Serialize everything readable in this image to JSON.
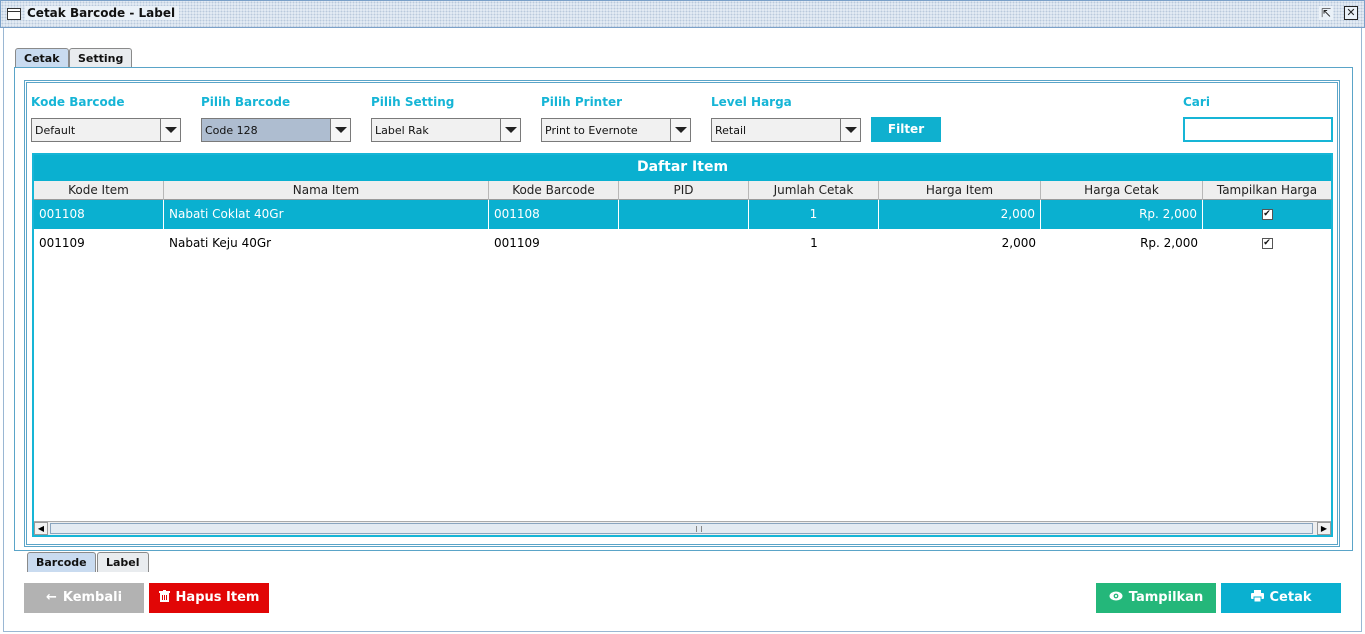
{
  "window": {
    "title": "Cetak Barcode - Label"
  },
  "tabs_top": [
    {
      "label": "Cetak",
      "active": true
    },
    {
      "label": "Setting",
      "active": false
    }
  ],
  "tabs_bottom": [
    {
      "label": "Barcode",
      "active": true
    },
    {
      "label": "Label",
      "active": false
    }
  ],
  "filters": {
    "kode_barcode": {
      "label": "Kode Barcode",
      "value": "Default"
    },
    "pilih_barcode": {
      "label": "Pilih Barcode",
      "value": "Code 128"
    },
    "pilih_setting": {
      "label": "Pilih Setting",
      "value": "Label Rak"
    },
    "pilih_printer": {
      "label": "Pilih Printer",
      "value": "Print to Evernote"
    },
    "level_harga": {
      "label": "Level Harga",
      "value": "Retail"
    },
    "filter_button": "Filter",
    "cari": {
      "label": "Cari",
      "value": ""
    }
  },
  "table": {
    "title": "Daftar Item",
    "columns": [
      "Kode Item",
      "Nama Item",
      "Kode Barcode",
      "PID",
      "Jumlah Cetak",
      "Harga Item",
      "Harga Cetak",
      "Tampilkan Harga"
    ],
    "rows": [
      {
        "kode_item": "001108",
        "nama_item": "Nabati Coklat 40Gr",
        "kode_barcode": "001108",
        "pid": "",
        "jumlah_cetak": "1",
        "harga_item": "2,000",
        "harga_cetak": "Rp. 2,000",
        "tampilkan_harga": true,
        "selected": true
      },
      {
        "kode_item": "001109",
        "nama_item": "Nabati Keju 40Gr",
        "kode_barcode": "001109",
        "pid": "",
        "jumlah_cetak": "1",
        "harga_item": "2,000",
        "harga_cetak": "Rp. 2,000",
        "tampilkan_harga": true,
        "selected": false
      }
    ]
  },
  "buttons": {
    "kembali": "Kembali",
    "hapus_item": "Hapus Item",
    "tampilkan": "Tampilkan",
    "cetak": "Cetak"
  },
  "icons": {
    "kembali": "arrow-left-icon",
    "hapus_item": "trash-icon",
    "tampilkan": "eye-icon",
    "cetak": "printer-icon"
  },
  "colors": {
    "accent": "#0ab0d0",
    "label": "#16b5d6",
    "danger": "#e10606",
    "success": "#24b77a",
    "disabled": "#b2b2b2"
  }
}
